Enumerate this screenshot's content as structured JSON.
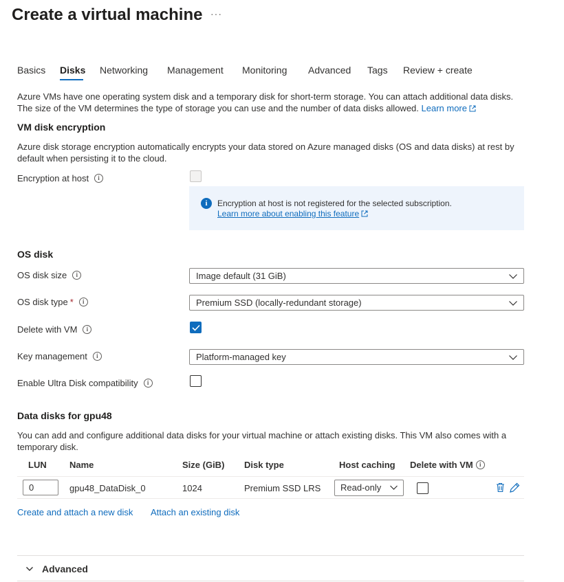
{
  "header": {
    "title": "Create a virtual machine",
    "more": "···"
  },
  "tabs": [
    {
      "label": "Basics"
    },
    {
      "label": "Disks"
    },
    {
      "label": "Networking"
    },
    {
      "label": "Management"
    },
    {
      "label": "Monitoring"
    },
    {
      "label": "Advanced"
    },
    {
      "label": "Tags"
    },
    {
      "label": "Review + create"
    }
  ],
  "intro": {
    "line1": "Azure VMs have one operating system disk and a temporary disk for short-term storage. You can attach additional data disks.",
    "line2": "The size of the VM determines the type of storage you can use and the number of data disks allowed.",
    "learn_more": "Learn more"
  },
  "encryption": {
    "heading": "VM disk encryption",
    "desc_line1": "Azure disk storage encryption automatically encrypts your data stored on Azure managed disks (OS and data disks) at rest by",
    "desc_line2": "default when persisting it to the cloud.",
    "at_host_label": "Encryption at host",
    "info_message": "Encryption at host is not registered for the selected subscription.",
    "info_link": "Learn more about enabling this feature"
  },
  "os_disk": {
    "heading": "OS disk",
    "size_label": "OS disk size",
    "size_value": "Image default (31 GiB)",
    "type_label": "OS disk type",
    "required_mark": "*",
    "type_value": "Premium SSD (locally-redundant storage)",
    "delete_label": "Delete with VM",
    "delete_checked": true,
    "key_label": "Key management",
    "key_value": "Platform-managed key",
    "ultra_label": "Enable Ultra Disk compatibility",
    "ultra_checked": false
  },
  "data_disks": {
    "heading": "Data disks for gpu48",
    "desc_line1": "You can add and configure additional data disks for your virtual machine or attach existing disks. This VM also comes with a",
    "desc_line2": "temporary disk.",
    "columns": {
      "lun": "LUN",
      "name": "Name",
      "size": "Size (GiB)",
      "type": "Disk type",
      "caching": "Host caching",
      "delete": "Delete with VM"
    },
    "rows": [
      {
        "lun": "0",
        "name": "gpu48_DataDisk_0",
        "size": "1024",
        "type": "Premium SSD LRS",
        "caching": "Read-only",
        "delete_with_vm": false
      }
    ],
    "create_link": "Create and attach a new disk",
    "attach_link": "Attach an existing disk"
  },
  "advanced": {
    "label": "Advanced"
  },
  "colors": {
    "accent": "#0f6cbd",
    "info_bg": "#eef4fc",
    "required": "#a4262c"
  },
  "icons": [
    "more-icon",
    "external-link-icon",
    "info-icon",
    "chevron-down-icon",
    "checkmark-icon",
    "trash-icon",
    "pencil-icon"
  ]
}
